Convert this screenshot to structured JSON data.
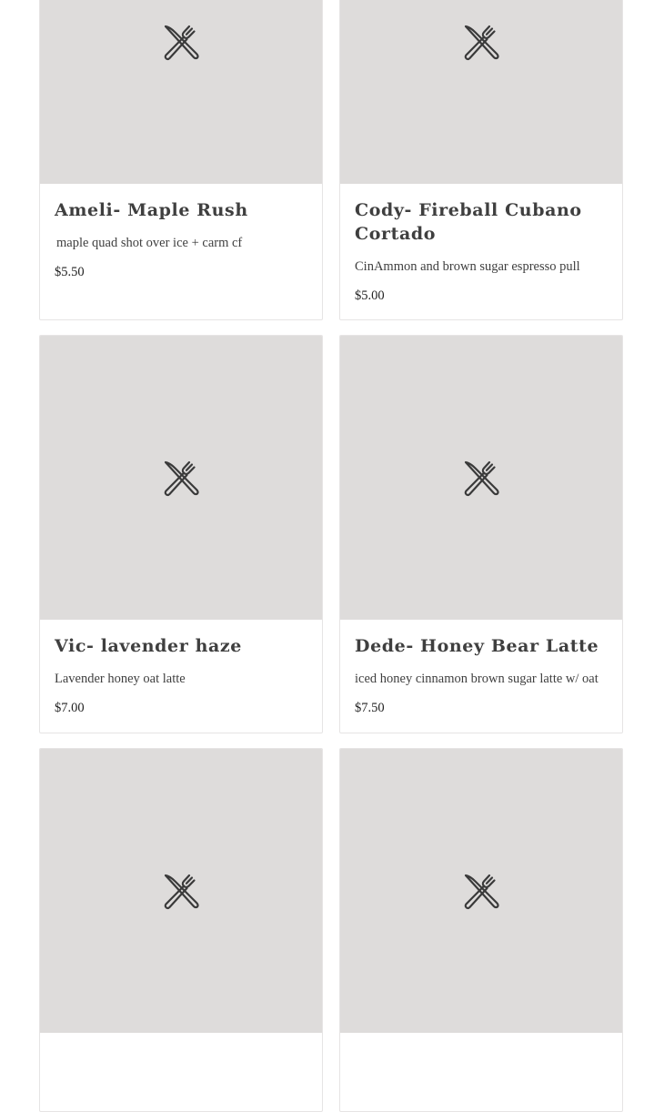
{
  "menu": {
    "items": [
      {
        "name": "Ameli- Maple Rush",
        "description": "maple quad shot over ice + carm cf",
        "price": "$5.50",
        "image_icon": "utensils-icon"
      },
      {
        "name": "Cody- Fireball Cubano Cortado",
        "description": "CinAmmon and brown sugar espresso pull",
        "price": "$5.00",
        "image_icon": "utensils-icon"
      },
      {
        "name": "Vic- lavender haze",
        "description": "Lavender honey oat latte",
        "price": "$7.00",
        "image_icon": "utensils-icon"
      },
      {
        "name": "Dede- Honey Bear Latte",
        "description": "iced honey cinnamon brown sugar latte w/ oat",
        "price": "$7.50",
        "image_icon": "utensils-icon"
      },
      {
        "name": "",
        "description": "",
        "price": "",
        "image_icon": "utensils-icon"
      },
      {
        "name": "",
        "description": "",
        "price": "",
        "image_icon": "utensils-icon"
      }
    ]
  },
  "colors": {
    "placeholder_bg": "#dedcdb",
    "card_border": "#e6e4e4",
    "text": "#3f3f3f"
  }
}
